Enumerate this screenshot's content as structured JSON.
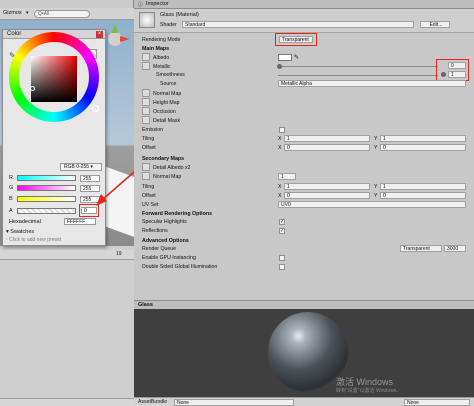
{
  "scene": {
    "gizmos": "Gizmos",
    "search_placeholder": "Q•All",
    "stats": "19"
  },
  "picker": {
    "title": "Color",
    "mode": "RGB 0-255",
    "channels": [
      {
        "label": "R",
        "value": "255"
      },
      {
        "label": "G",
        "value": "255"
      },
      {
        "label": "B",
        "value": "255"
      },
      {
        "label": "A",
        "value": "0"
      }
    ],
    "hex_label": "Hexadecimal",
    "hex_value": "FFFFFF",
    "swatches_label": "Swatches",
    "add_preset": "Click to add new preset"
  },
  "inspector": {
    "tab": "Inspector",
    "material_name": "Glass (Material)",
    "shader_label": "Shader",
    "shader_value": "Standard",
    "edit_button": "Edit...",
    "rendering_mode_label": "Rendering Mode",
    "rendering_mode_value": "Transparent",
    "main_maps": "Main Maps",
    "albedo": "Albedo",
    "metallic": "Metallic",
    "metallic_value": "0",
    "smoothness": "Smoothness",
    "smoothness_value": "1",
    "source_label": "Source",
    "source_value": "Metallic Alpha",
    "normal_map": "Normal Map",
    "height_map": "Height Map",
    "occlusion": "Occlusion",
    "detail_mask": "Detail Mask",
    "emission": "Emission",
    "tiling": "Tiling",
    "offset": "Offset",
    "tiling_x": "1",
    "tiling_y": "1",
    "offset_x": "0",
    "offset_y": "0",
    "secondary_maps": "Secondary Maps",
    "detail_albedo": "Detail Albedo x2",
    "normal_map2": "Normal Map",
    "normal_map2_value": "1",
    "tiling2_x": "1",
    "tiling2_y": "1",
    "offset2_x": "0",
    "offset2_y": "0",
    "uv_set_label": "UV Set",
    "uv_set_value": "UV0",
    "fwd_options": "Forward Rendering Options",
    "specular": "Specular Highlights",
    "reflections": "Reflections",
    "advanced": "Advanced Options",
    "render_queue_label": "Render Queue",
    "render_queue_mode": "Transparent",
    "render_queue_value": "3000",
    "gpu_instancing": "Enable GPU Instancing",
    "double_sided": "Double Sided Global Illumination",
    "preview_title": "Glass",
    "assetbundle_label": "AssetBundle",
    "assetbundle_value": "None",
    "assetbundle_variant": "None",
    "watermark_title": "激活 Windows",
    "watermark_sub": "转到\"设置\"以激活 Windows。"
  },
  "colors": {
    "highlight": "#e3261e"
  }
}
